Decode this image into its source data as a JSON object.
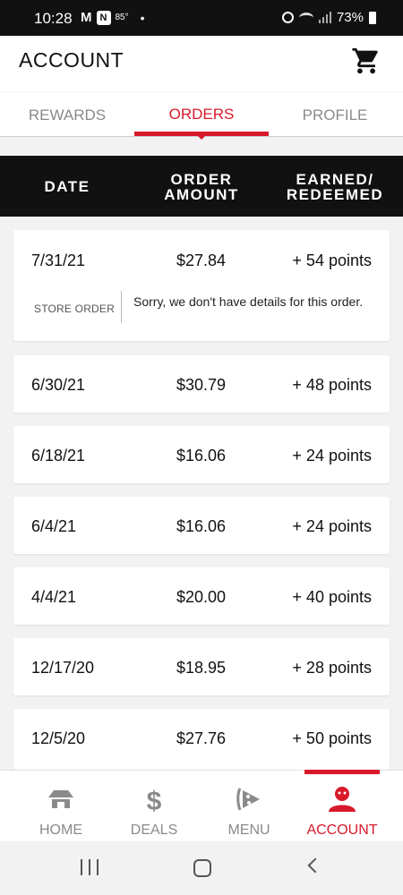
{
  "status_bar": {
    "time": "10:28",
    "temperature": "85°",
    "battery": "73%"
  },
  "header": {
    "title": "ACCOUNT",
    "cart_icon": "shopping-cart-icon"
  },
  "tabs": [
    {
      "label": "REWARDS",
      "active": false
    },
    {
      "label": "ORDERS",
      "active": true
    },
    {
      "label": "PROFILE",
      "active": false
    }
  ],
  "table": {
    "headers": {
      "date": "DATE",
      "amount_line1": "ORDER",
      "amount_line2": "AMOUNT",
      "earned_line1": "EARNED/",
      "earned_line2": "REDEEMED"
    },
    "orders": [
      {
        "date": "7/31/21",
        "amount": "$27.84",
        "points": "+ 54 points",
        "type": "STORE ORDER",
        "note": "Sorry, we don't have details for this order."
      },
      {
        "date": "6/30/21",
        "amount": "$30.79",
        "points": "+ 48 points"
      },
      {
        "date": "6/18/21",
        "amount": "$16.06",
        "points": "+ 24 points"
      },
      {
        "date": "6/4/21",
        "amount": "$16.06",
        "points": "+ 24 points"
      },
      {
        "date": "4/4/21",
        "amount": "$20.00",
        "points": "+ 40 points"
      },
      {
        "date": "12/17/20",
        "amount": "$18.95",
        "points": "+ 28 points"
      },
      {
        "date": "12/5/20",
        "amount": "$27.76",
        "points": "+ 50 points"
      }
    ]
  },
  "bottom_nav": [
    {
      "label": "HOME",
      "icon": "hut-icon",
      "active": false
    },
    {
      "label": "DEALS",
      "icon": "dollar-icon",
      "active": false
    },
    {
      "label": "MENU",
      "icon": "pizza-slice-icon",
      "active": false
    },
    {
      "label": "ACCOUNT",
      "icon": "user-icon",
      "active": true
    }
  ],
  "colors": {
    "accent": "#d9192b",
    "header_bar": "#111111",
    "inactive": "#8a8a8a"
  }
}
